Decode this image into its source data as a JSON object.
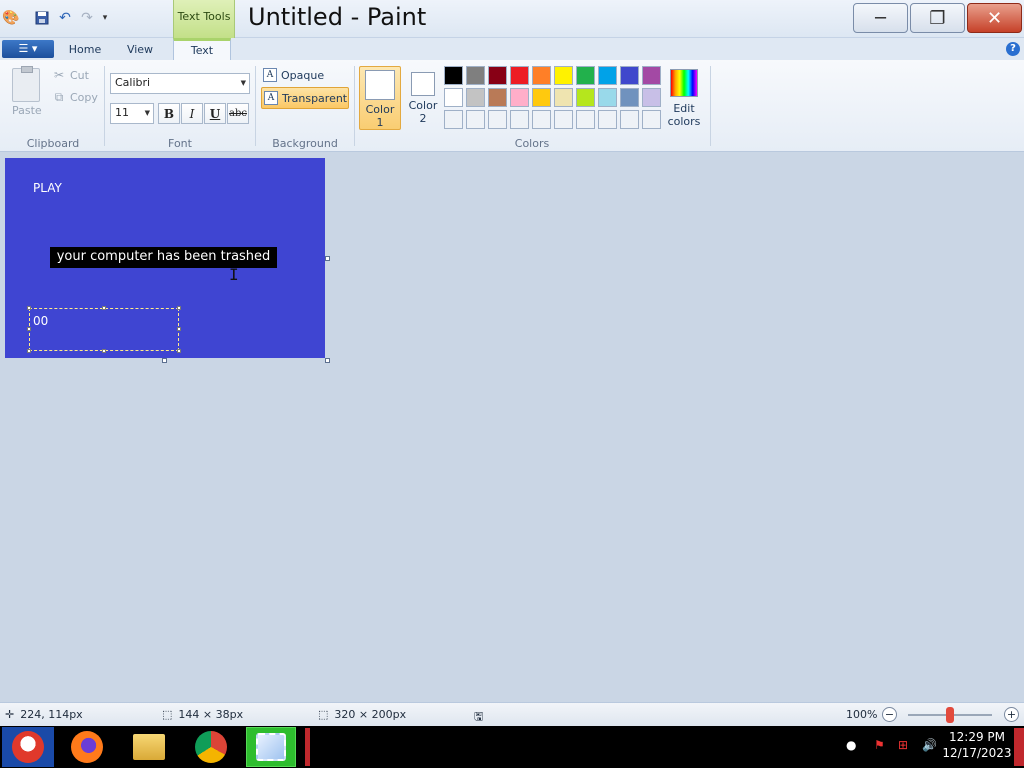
{
  "window": {
    "title": "Untitled - Paint",
    "context_tab": "Text Tools",
    "buttons": {
      "minimize": "minimize-icon",
      "restore": "restore-icon",
      "close": "close-icon"
    }
  },
  "ribbon_tabs": [
    "Home",
    "View",
    "Text"
  ],
  "active_tab": "Text",
  "clipboard": {
    "paste": "Paste",
    "cut": "Cut",
    "copy": "Copy",
    "group": "Clipboard"
  },
  "font": {
    "family": "Calibri",
    "size": "11",
    "bold": "B",
    "italic": "I",
    "underline": "U",
    "strike": "abc",
    "group": "Font"
  },
  "background": {
    "opaque": "Opaque",
    "transparent": "Transparent",
    "group": "Background",
    "selected": "Transparent"
  },
  "colors": {
    "color1_label": "Color",
    "color1_num": "1",
    "color2_label": "Color",
    "color2_num": "2",
    "color1_value": "#ffffff",
    "color2_value": "#ffffff",
    "edit_label_1": "Edit",
    "edit_label_2": "colors",
    "group": "Colors",
    "palette_row1": [
      "#000000",
      "#7f7f7f",
      "#880015",
      "#ed1c24",
      "#ff7f27",
      "#fff200",
      "#22b14c",
      "#00a2e8",
      "#3f48cc",
      "#a349a4"
    ],
    "palette_row2": [
      "#ffffff",
      "#c3c3c3",
      "#b97a57",
      "#ffaec9",
      "#ffc90e",
      "#efe4b0",
      "#b5e61d",
      "#99d9ea",
      "#7092be",
      "#c8bfe7"
    ]
  },
  "canvas": {
    "background": "#3f45d2",
    "text_play": "PLAY",
    "text_trashed": "your computer has been trashed",
    "text_box_content": "00"
  },
  "status": {
    "cursor_pos": "224, 114px",
    "selection_size": "144 × 38px",
    "image_size": "320 × 200px",
    "zoom": "100%"
  },
  "taskbar": {
    "time": "12:29 PM",
    "date": "12/17/2023",
    "apps": [
      "start-icon",
      "firefox-icon",
      "file-explorer-icon",
      "chrome-icon",
      "paint-icon"
    ]
  }
}
